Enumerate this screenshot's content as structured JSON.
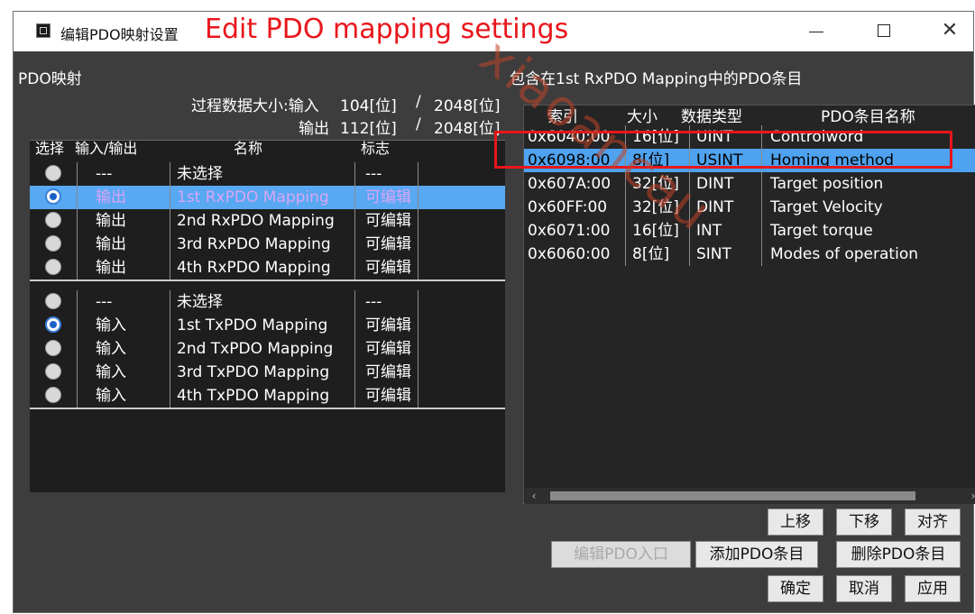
{
  "window": {
    "title_cn": "编辑PDO映射设置",
    "title_en": "Edit PDO mapping settings",
    "controls": {
      "minimize": "—",
      "maximize": "☐",
      "close": "✕"
    }
  },
  "left": {
    "pane_title": "PDO映射",
    "data_size": {
      "label_input": "过程数据大小:输入",
      "input_value": "104[位]",
      "sep1": "/",
      "input_max": "2048[位]",
      "label_output": "输出",
      "output_value": "112[位]",
      "sep2": "/",
      "output_max": "2048[位]"
    },
    "columns": [
      "选择",
      "输入/输出",
      "名称",
      "标志"
    ],
    "rows": [
      {
        "io": "---",
        "name": "未选择",
        "flag": "---",
        "selected": false
      },
      {
        "io": "输出",
        "name": "1st RxPDO Mapping",
        "flag": "可编辑",
        "selected": true
      },
      {
        "io": "输出",
        "name": "2nd RxPDO Mapping",
        "flag": "可编辑",
        "selected": false
      },
      {
        "io": "输出",
        "name": "3rd RxPDO Mapping",
        "flag": "可编辑",
        "selected": false
      },
      {
        "io": "输出",
        "name": "4th RxPDO Mapping",
        "flag": "可编辑",
        "selected": false
      },
      {
        "io": "---",
        "name": "未选择",
        "flag": "---",
        "selected": false
      },
      {
        "io": "输入",
        "name": "1st TxPDO Mapping",
        "flag": "可编辑",
        "selected": true
      },
      {
        "io": "输入",
        "name": "2nd TxPDO Mapping",
        "flag": "可编辑",
        "selected": false
      },
      {
        "io": "输入",
        "name": "3rd TxPDO Mapping",
        "flag": "可编辑",
        "selected": false
      },
      {
        "io": "输入",
        "name": "4th TxPDO Mapping",
        "flag": "可编辑",
        "selected": false
      }
    ]
  },
  "right": {
    "pane_title": "包含在1st RxPDO Mapping中的PDO条目",
    "columns": [
      "索引",
      "大小",
      "数据类型",
      "PDO条目名称"
    ],
    "rows": [
      {
        "index": "0x6040:00",
        "size": "16[位]",
        "type": "UINT",
        "name": "Controlword"
      },
      {
        "index": "0x6098:00",
        "size": "8[位]",
        "type": "USINT",
        "name": "Homing method"
      },
      {
        "index": "0x607A:00",
        "size": "32[位]",
        "type": "DINT",
        "name": "Target position"
      },
      {
        "index": "0x60FF:00",
        "size": "32[位]",
        "type": "DINT",
        "name": "Target Velocity"
      },
      {
        "index": "0x6071:00",
        "size": "16[位]",
        "type": "INT",
        "name": "Target torque"
      },
      {
        "index": "0x6060:00",
        "size": "8[位]",
        "type": "SINT",
        "name": "Modes of operation"
      }
    ]
  },
  "buttons": {
    "up": "上移",
    "down": "下移",
    "align": "对齐",
    "edit_pdo_entry": "编辑PDO入口",
    "add_pdo_entry": "添加PDO条目",
    "delete_pdo_entry": "删除PDO条目",
    "ok": "确定",
    "cancel": "取消",
    "apply": "应用"
  },
  "watermark": "xiaoancau",
  "colors": {
    "annotation_red": "#e8161b",
    "selection_blue": "#4ea2ef",
    "dialog_bg": "#3d3d3d"
  }
}
